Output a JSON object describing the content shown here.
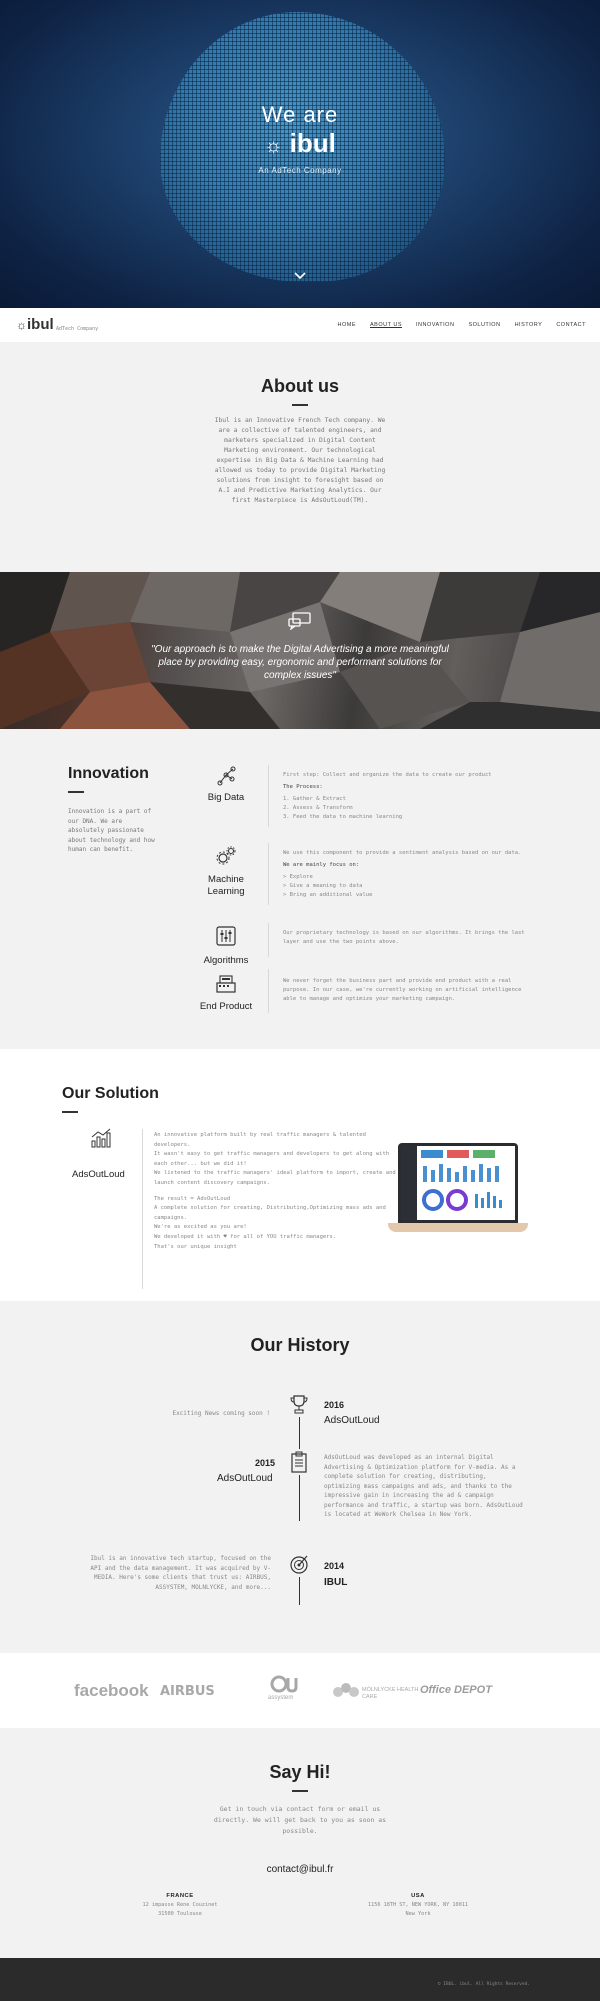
{
  "hero": {
    "we_are": "We are",
    "logo": "ibul",
    "subtitle": "An AdTech Company"
  },
  "nav": {
    "logo": "ibul",
    "tagline": "AdTech Company",
    "links": [
      "HOME",
      "ABOUT US",
      "INNOVATION",
      "SOLUTION",
      "HISTORY",
      "CONTACT"
    ],
    "active": "ABOUT US"
  },
  "about": {
    "title": "About us",
    "body": "Ibul is an Innovative French Tech company. We are a collective of talented engineers, and marketers specialized in Digital Content Marketing environment. Our technological expertise in Big Data & Machine Learning had allowed us today to provide Digital Marketing solutions from insight to foresight based on A.I and Predictive Marketing Analytics. Our first Masterpiece is AdsOutLoud(TM)."
  },
  "quote": {
    "text": "\"Our approach is to make the Digital Advertising a more meaningful place by providing easy, ergonomic and performant solutions for complex issues\""
  },
  "innovation": {
    "title": "Innovation",
    "description": "Innovation is a part of our DNA. We are absolutely passionate about technology and how human can benefit.",
    "items": [
      {
        "label": "Big Data",
        "intro": "First step: Collect and organize the data to create our product",
        "heading": "The Process:",
        "points": [
          "1. Gather & Extract",
          "2. Assess & Transform",
          "3. Feed the data to machine learning"
        ]
      },
      {
        "label": "Machine Learning",
        "intro": "We use this component to provide a sentiment analysis based on our data.",
        "heading": "We are mainly focus on:",
        "points": [
          "> Explore",
          "> Give a meaning to data",
          "> Bring an additional value"
        ]
      },
      {
        "label": "Algorithms",
        "intro": "Our proprietary technology is based on our algorithms. It brings the last layer and use the two points above.",
        "heading": "",
        "points": []
      },
      {
        "label": "End Product",
        "intro": "We never forget the business part and provide end product with a real purpose. In our case, we're currently working on artificial intelligence able to manage and optimize your marketing campaign.",
        "heading": "",
        "points": []
      }
    ]
  },
  "solution": {
    "title": "Our Solution",
    "product": "AdsOutLoud",
    "lines": [
      "An innovative platform built by real traffic managers & talented developers.",
      "It wasn't easy to get traffic managers and developers to get along with each other... but we did it!",
      "We listened to the traffic managers' ideal platform to import, create and launch content discovery campaigns.",
      "",
      "The result = AdsOutLoud",
      "A complete solution for creating, Distributing,Optimizing mass ads and campaigns.",
      "We're as excited as you are!",
      "We developed it with ♥ for all of YOU traffic managers.",
      "That's our unique insight"
    ]
  },
  "history": {
    "title": "Our History",
    "entries": [
      {
        "year": "2016",
        "name": "AdsOutLoud",
        "text": "Exciting News coming soon !"
      },
      {
        "year": "2015",
        "name": "AdsOutLoud",
        "text": "AdsOutLoud was developed as an internal Digital Advertising & Optimization platform for V-media. As a complete solution for creating, distributing, optimizing mass campaigns and ads, and thanks to the impressive gain in increasing the ad & campaign performance and traffic, a startup was born. AdsOutLoud is located at WeWork Chelsea in New York."
      },
      {
        "year": "2014",
        "name": "IBUL",
        "text": "Ibul is an innovative tech startup, focused on the API and the data management. It was acquired by V-MEDIA. Here's some clients that trust us: AIRBUS, ASSYSTEM, MOLNLYCKE, and more..."
      }
    ]
  },
  "clients": [
    "facebook",
    "AIRBUS",
    "assystem",
    "MÖLNLYCKE HEALTH CARE",
    "Office DEPOT"
  ],
  "contact": {
    "title": "Say Hi!",
    "body": "Get in touch via contact form or email us directly. We will get back to you as soon as possible.",
    "email": "contact@ibul.fr",
    "offices": [
      {
        "country": "FRANCE",
        "line1": "12 impasse Rene Couzinet",
        "line2": "31500 Toulouse"
      },
      {
        "country": "USA",
        "line1": "1156 18TH ST, NEW YORK, NY 10011",
        "line2": "New York"
      }
    ]
  },
  "footer": {
    "copyright": "© IBUL. ibul. All Rights Reserved."
  }
}
